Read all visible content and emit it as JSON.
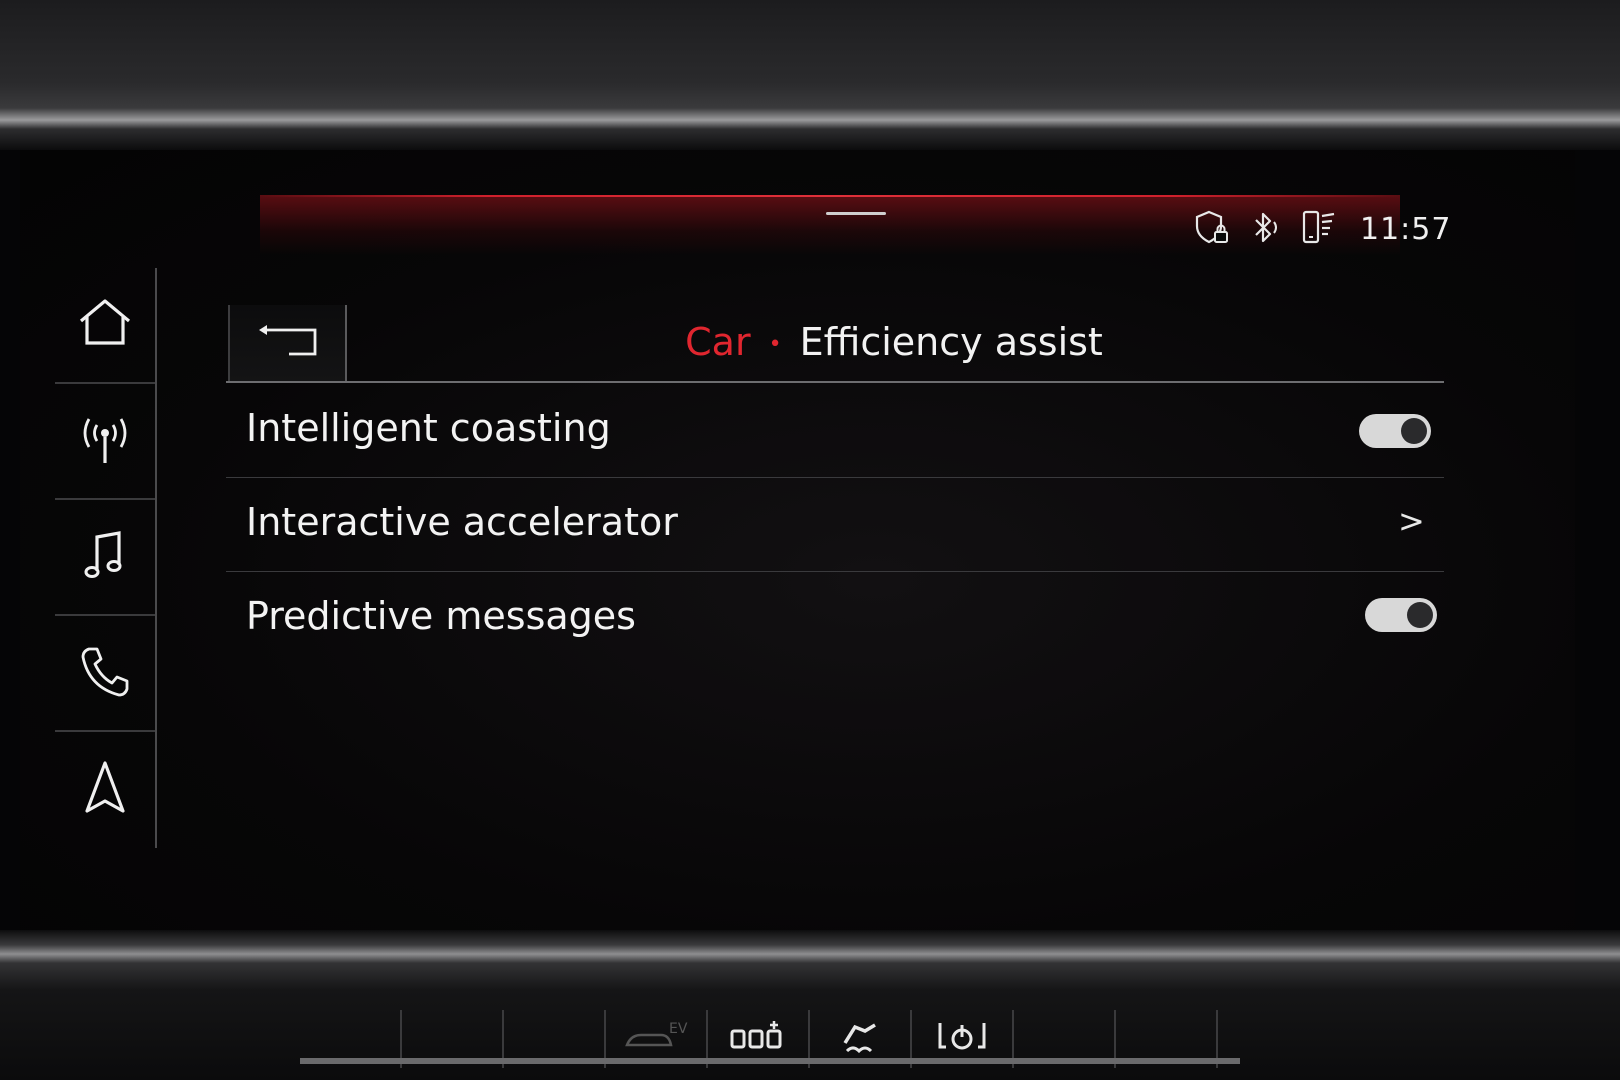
{
  "status_bar": {
    "time": "11:57",
    "icons": [
      "privacy-shield-lock-icon",
      "bluetooth-icon",
      "phone-signal-icon"
    ]
  },
  "dock": {
    "items": [
      {
        "icon": "home-icon"
      },
      {
        "icon": "radio-icon"
      },
      {
        "icon": "music-icon"
      },
      {
        "icon": "phone-icon"
      },
      {
        "icon": "navigation-icon"
      }
    ]
  },
  "header": {
    "back_icon": "back-arrow-icon",
    "breadcrumb_parent": "Car",
    "separator": "•",
    "title": "Efficiency assist"
  },
  "settings": {
    "items": [
      {
        "label": "Intelligent coasting",
        "control": "toggle",
        "state": "on"
      },
      {
        "label": "Interactive accelerator",
        "control": "chevron",
        "chevron": ">"
      },
      {
        "label": "Predictive messages",
        "control": "toggle",
        "state": "on"
      }
    ]
  },
  "hardware_buttons": {
    "icons": [
      "ev-mode-icon",
      "parking-sensor-icon",
      "traction-control-off-icon",
      "start-stop-icon"
    ]
  },
  "colors": {
    "accent": "#e0262f",
    "text": "#f2f2f2",
    "background": "#050506"
  }
}
